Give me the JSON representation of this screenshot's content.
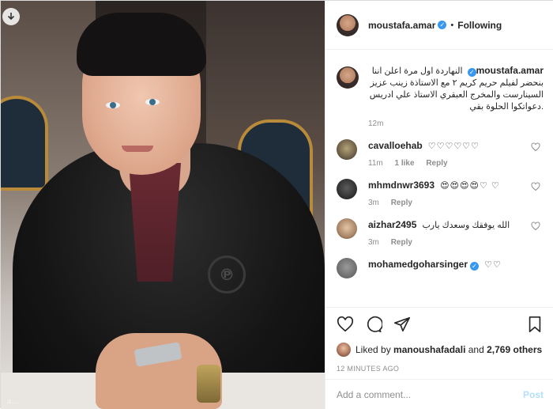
{
  "post": {
    "username": "moustafa.amar",
    "verified": true,
    "follow_status": "Following",
    "separator": "•",
    "photo_watermark": "a..."
  },
  "caption": {
    "username": "moustafa.amar",
    "text": "النهاردة اول مرة اعلن اننا بنحضر لفيلم حريم كريم ٢ مع الاستاذة زينب عزيز السينارست والمخرج العبقري الاستاذ علي ادريس .دعواتكوا الحلوة بقي",
    "time": "12m"
  },
  "comments": [
    {
      "username": "cavalloehab",
      "text": "♡♡♡♡♡♡",
      "time": "11m",
      "likes": "1 like",
      "reply": "Reply"
    },
    {
      "username": "mhmdnwr3693",
      "text": "😍😍😍😍♡ ♡",
      "time": "3m",
      "likes": "",
      "reply": "Reply"
    },
    {
      "username": "aizhar2495",
      "text": "الله يوفقك وسعدك يارب",
      "time": "3m",
      "likes": "",
      "reply": "Reply"
    },
    {
      "username": "mohamedgoharsinger",
      "text": "♡♡",
      "time": "",
      "likes": "",
      "reply": ""
    }
  ],
  "likes": {
    "prefix": "Liked by",
    "user": "manoushafadali",
    "connector": "and",
    "others": "2,769 others"
  },
  "timestamp": "12 MINUTES AGO",
  "add_comment": {
    "placeholder": "Add a comment...",
    "post_label": "Post"
  },
  "colors": {
    "verified_blue": "#3897f0",
    "post_disabled": "#b2dffc",
    "muted_text": "#8e8e8e",
    "text": "#262626"
  }
}
